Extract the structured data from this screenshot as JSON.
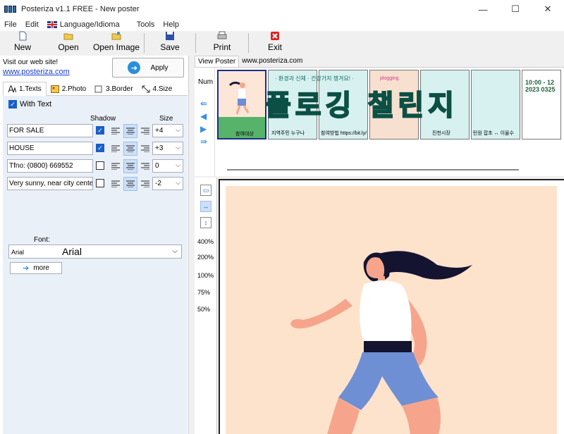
{
  "window": {
    "title": "Posteriza v1.1 FREE - New poster",
    "minimize": "—",
    "maximize": "☐",
    "close": "✕"
  },
  "menu": {
    "items": [
      "File",
      "Edit",
      "Language/Idioma",
      "Tools",
      "Help"
    ]
  },
  "toolbar": {
    "new": "New",
    "open": "Open",
    "open_image": "Open Image",
    "save": "Save",
    "print": "Print",
    "exit": "Exit"
  },
  "left": {
    "site_label": "Visit our web site!",
    "site_link": "www.posteriza.com",
    "apply": "Apply",
    "tabs": [
      "1.Texts",
      "2.Photo",
      "3.Border",
      "4.Size"
    ],
    "with_text": "With Text",
    "shadow_header": "Shadow",
    "size_header": "Size",
    "rows": [
      {
        "text": "FOR SALE",
        "shadow": true,
        "align": "center",
        "size": "+4"
      },
      {
        "text": "HOUSE",
        "shadow": true,
        "align": "center",
        "size": "+3"
      },
      {
        "text": "Tfno: (0800) 669552",
        "shadow": false,
        "align": "center",
        "size": "0"
      },
      {
        "text": "Very sunny, near city center",
        "shadow": false,
        "align": "center",
        "size": "-2"
      }
    ],
    "font_label": "Font:",
    "font_small": "Arial",
    "font_big": "Arial",
    "more": "more"
  },
  "view": {
    "tabs": [
      "View Poster",
      "www.posteriza.com"
    ],
    "num_label": "Num",
    "thumbs": [
      {
        "text": "참여대상"
      },
      {
        "text": "지역주민 누구나"
      },
      {
        "text": "참여방법 https://bit.ly/"
      },
      {
        "text": "plogging"
      },
      {
        "text": "진천시장"
      },
      {
        "text": "탄원 잡초 ↔ 이율수"
      },
      {
        "text": "10:00 - 12 2023 0325"
      }
    ],
    "banner": "플로깅 챌린지",
    "banner_sub": "· 환경과 신체 · 건강가지 챙겨요! ·",
    "zoom_levels": [
      "400%",
      "200%",
      "100%",
      "75%",
      "50%"
    ]
  },
  "colors": {
    "accent": "#1a5fc8",
    "poster_bg": "#fde3cc",
    "banner_green": "#1f8f7a",
    "link": "#1a3fd0"
  }
}
